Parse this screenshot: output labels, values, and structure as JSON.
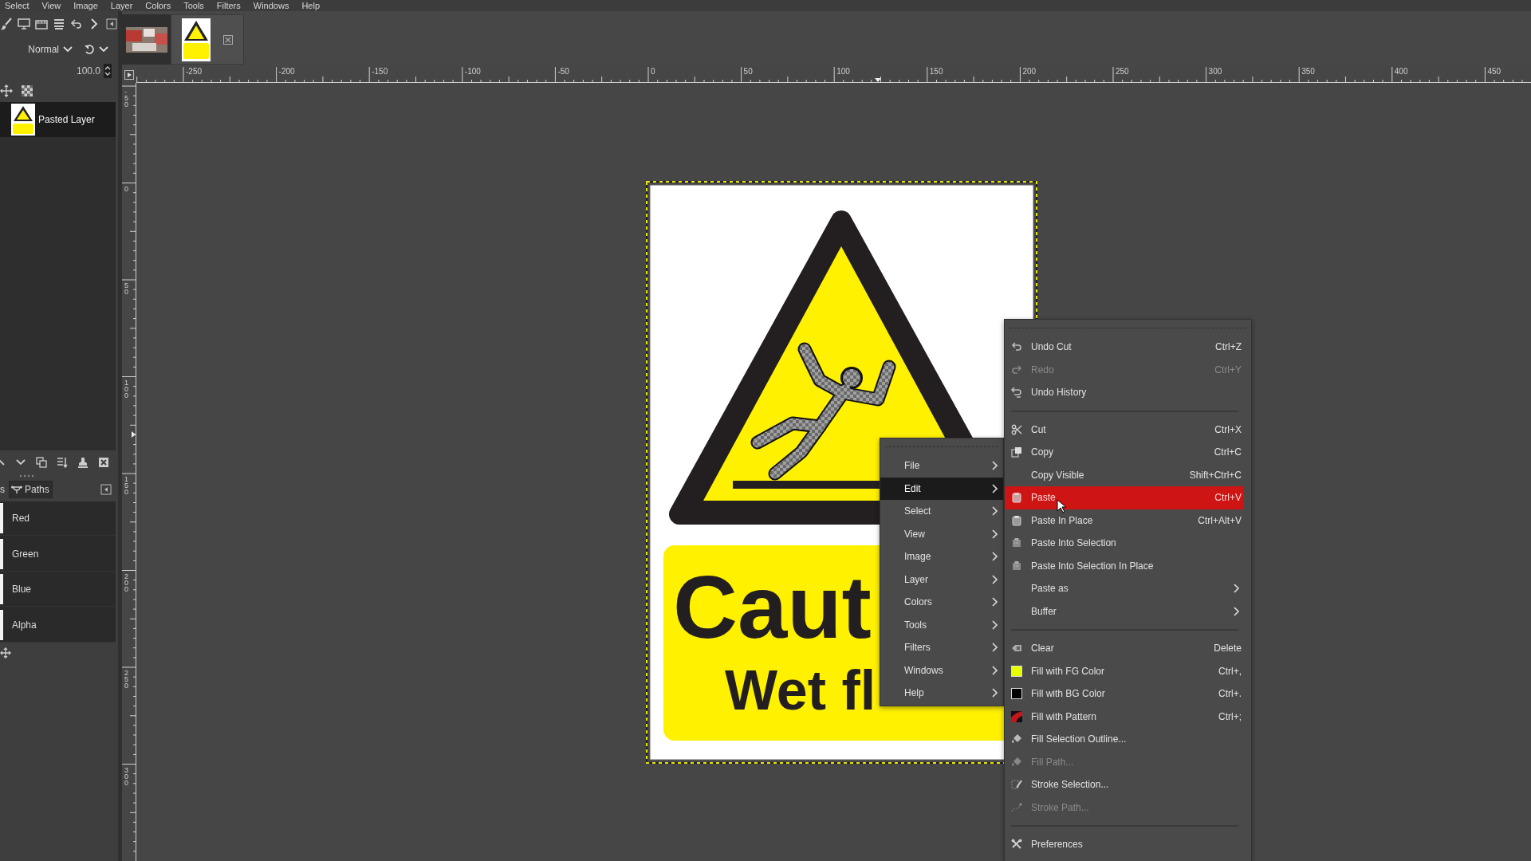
{
  "menubar": [
    "Select",
    "View",
    "Image",
    "Layer",
    "Colors",
    "Tools",
    "Filters",
    "Windows",
    "Help"
  ],
  "tool_options": {
    "mode": "Normal",
    "opacity": "100.0"
  },
  "image_tabs": [
    {
      "kind": "photo",
      "selected": false
    },
    {
      "kind": "sign",
      "selected": true
    }
  ],
  "layers": [
    {
      "name": "Pasted Layer",
      "selected": true
    }
  ],
  "dock_tabs": [
    {
      "label": "s",
      "selected": true
    },
    {
      "label": "Paths",
      "selected": false
    }
  ],
  "channels": [
    {
      "name": "Red"
    },
    {
      "name": "Green"
    },
    {
      "name": "Blue"
    },
    {
      "name": "Alpha"
    }
  ],
  "rulers": {
    "horizontal": [
      "-250",
      "-200",
      "-150",
      "-100",
      "-50",
      "0",
      "50",
      "100",
      "150",
      "200",
      "250",
      "300",
      "350",
      "400",
      "450"
    ],
    "vertical": [
      "-50",
      "0",
      "50",
      "100",
      "150",
      "200",
      "250",
      "300"
    ]
  },
  "canvas": {
    "sign_heading": "Caut",
    "sign_subheading": "Wet fl"
  },
  "context_menu": {
    "items": [
      {
        "label": "File",
        "selected": false
      },
      {
        "label": "Edit",
        "selected": true
      },
      {
        "label": "Select",
        "selected": false
      },
      {
        "label": "View",
        "selected": false
      },
      {
        "label": "Image",
        "selected": false
      },
      {
        "label": "Layer",
        "selected": false
      },
      {
        "label": "Colors",
        "selected": false
      },
      {
        "label": "Tools",
        "selected": false
      },
      {
        "label": "Filters",
        "selected": false
      },
      {
        "label": "Windows",
        "selected": false
      },
      {
        "label": "Help",
        "selected": false
      }
    ]
  },
  "edit_menu": {
    "items": [
      {
        "kind": "item",
        "label": "Undo Cut",
        "shortcut": "Ctrl+Z",
        "disabled": false,
        "selected": false
      },
      {
        "kind": "item",
        "label": "Redo",
        "shortcut": "Ctrl+Y",
        "disabled": true,
        "selected": false
      },
      {
        "kind": "item",
        "label": "Undo History",
        "disabled": false,
        "selected": false
      },
      {
        "kind": "separator"
      },
      {
        "kind": "item",
        "label": "Cut",
        "shortcut": "Ctrl+X",
        "disabled": false,
        "selected": false
      },
      {
        "kind": "item",
        "label": "Copy",
        "shortcut": "Ctrl+C",
        "disabled": false,
        "selected": false
      },
      {
        "kind": "item",
        "label": "Copy Visible",
        "shortcut": "Shift+Ctrl+C",
        "disabled": false,
        "selected": false
      },
      {
        "kind": "item",
        "label": "Paste",
        "shortcut": "Ctrl+V",
        "disabled": false,
        "selected": true
      },
      {
        "kind": "item",
        "label": "Paste In Place",
        "shortcut": "Ctrl+Alt+V",
        "disabled": false,
        "selected": false
      },
      {
        "kind": "item",
        "label": "Paste Into Selection",
        "disabled": false,
        "selected": false
      },
      {
        "kind": "item",
        "label": "Paste Into Selection In Place",
        "disabled": false,
        "selected": false
      },
      {
        "kind": "submenu",
        "label": "Paste as",
        "disabled": false,
        "selected": false
      },
      {
        "kind": "submenu",
        "label": "Buffer",
        "disabled": false,
        "selected": false
      },
      {
        "kind": "separator"
      },
      {
        "kind": "item",
        "label": "Clear",
        "shortcut": "Delete",
        "disabled": false,
        "selected": false
      },
      {
        "kind": "item",
        "label": "Fill with FG Color",
        "shortcut": "Ctrl+,",
        "color": "#e8ff00",
        "disabled": false,
        "selected": false
      },
      {
        "kind": "item",
        "label": "Fill with BG Color",
        "shortcut": "Ctrl+.",
        "color": "#000000",
        "disabled": false,
        "selected": false
      },
      {
        "kind": "item",
        "label": "Fill with Pattern",
        "shortcut": "Ctrl+;",
        "disabled": false,
        "selected": false
      },
      {
        "kind": "item",
        "label": "Fill Selection Outline...",
        "disabled": false,
        "selected": false
      },
      {
        "kind": "item",
        "label": "Fill Path...",
        "disabled": true,
        "selected": false
      },
      {
        "kind": "item",
        "label": "Stroke Selection...",
        "disabled": false,
        "selected": false
      },
      {
        "kind": "item",
        "label": "Stroke Path...",
        "disabled": true,
        "selected": false
      },
      {
        "kind": "separator"
      },
      {
        "kind": "item",
        "label": "Preferences",
        "disabled": false,
        "selected": false
      }
    ]
  }
}
